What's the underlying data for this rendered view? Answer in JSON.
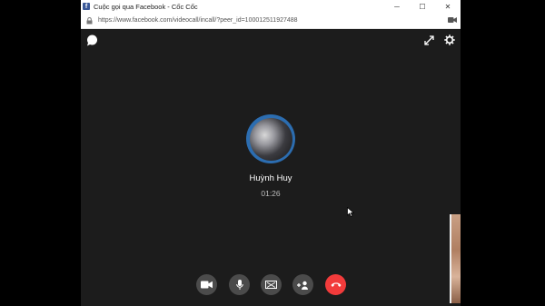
{
  "window": {
    "title": "Cuộc gọi qua Facebook - Cốc Cốc",
    "favicon_letter": "f",
    "controls": {
      "minimize": "─",
      "maximize": "☐",
      "close": "✕"
    }
  },
  "address_bar": {
    "url": "https://www.facebook.com/videocall/incall/?peer_id=100012511927488"
  },
  "call": {
    "caller_name": "Huỳnh Huy",
    "duration": "01:26"
  },
  "colors": {
    "background": "#1c1c1c",
    "end_call": "#f23b3b",
    "control_button": "#4b4b4b",
    "avatar_ring": "#2c6db0"
  }
}
